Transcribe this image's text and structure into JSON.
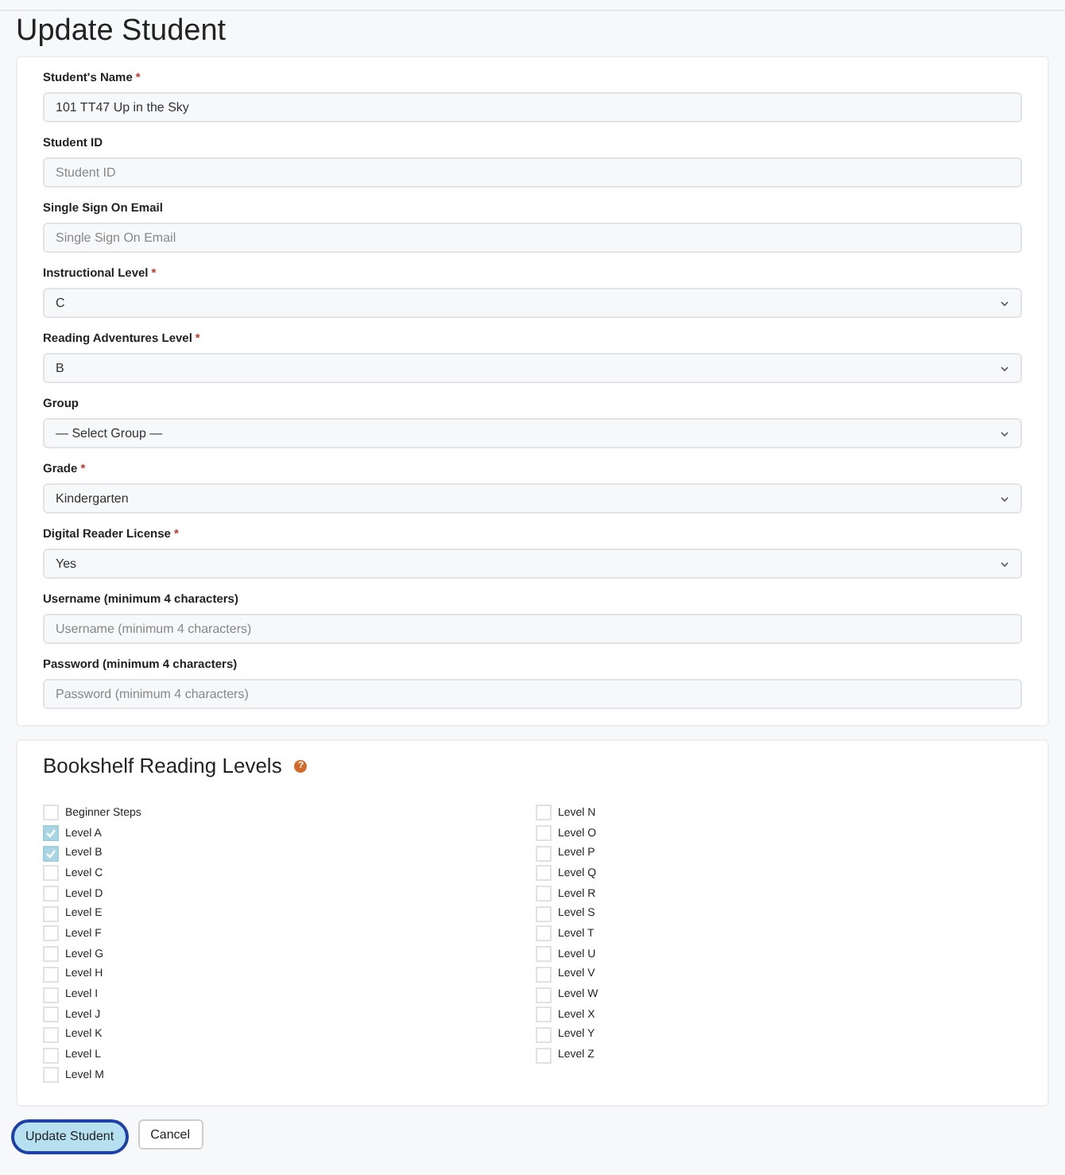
{
  "title": "Update Student",
  "fields": [
    {
      "label": "Student's Name",
      "marker": "*",
      "kind": "text",
      "value": "101 TT47 Up in the Sky"
    },
    {
      "label": "Student ID",
      "kind": "text",
      "placeholder": "Student ID"
    },
    {
      "label": "Single Sign On Email",
      "kind": "text",
      "placeholder": "Single Sign On Email"
    },
    {
      "label": "Instructional Level",
      "marker": "*",
      "kind": "select",
      "value": "C"
    },
    {
      "label": "Reading Adventures Level",
      "marker": "*",
      "kind": "select",
      "value": "B"
    },
    {
      "label": "Group",
      "kind": "select",
      "value": "— Select Group —"
    },
    {
      "label": "Grade",
      "marker": "*",
      "kind": "select",
      "value": "Kindergarten"
    },
    {
      "label": "Digital Reader License",
      "marker": "*",
      "kind": "select",
      "value": "Yes"
    },
    {
      "label": "Username (minimum 4 characters)",
      "kind": "text",
      "placeholder": "Username (minimum 4 characters)"
    },
    {
      "label": "Password (minimum 4 characters)",
      "kind": "text",
      "placeholder": "Password (minimum 4 characters)"
    }
  ],
  "bookshelf": {
    "title": "Bookshelf Reading Levels",
    "help": "?",
    "columns": [
      [
        {
          "label": "Beginner Steps",
          "checked": false
        },
        {
          "label": "Level A",
          "checked": true
        },
        {
          "label": "Level B",
          "checked": true
        },
        {
          "label": "Level C",
          "checked": false
        },
        {
          "label": "Level D",
          "checked": false
        },
        {
          "label": "Level E",
          "checked": false
        },
        {
          "label": "Level F",
          "checked": false
        },
        {
          "label": "Level G",
          "checked": false
        },
        {
          "label": "Level H",
          "checked": false
        },
        {
          "label": "Level I",
          "checked": false
        },
        {
          "label": "Level J",
          "checked": false
        },
        {
          "label": "Level K",
          "checked": false
        },
        {
          "label": "Level L",
          "checked": false
        },
        {
          "label": "Level M",
          "checked": false
        }
      ],
      [
        {
          "label": "Level N",
          "checked": false
        },
        {
          "label": "Level O",
          "checked": false
        },
        {
          "label": "Level P",
          "checked": false
        },
        {
          "label": "Level Q",
          "checked": false
        },
        {
          "label": "Level R",
          "checked": false
        },
        {
          "label": "Level S",
          "checked": false
        },
        {
          "label": "Level T",
          "checked": false
        },
        {
          "label": "Level U",
          "checked": false
        },
        {
          "label": "Level V",
          "checked": false
        },
        {
          "label": "Level W",
          "checked": false
        },
        {
          "label": "Level X",
          "checked": false
        },
        {
          "label": "Level Y",
          "checked": false
        },
        {
          "label": "Level Z",
          "checked": false
        }
      ]
    ]
  },
  "buttons": [
    {
      "label": "Update Student",
      "kind": "primary"
    },
    {
      "label": "Cancel",
      "kind": "secondary"
    }
  ]
}
